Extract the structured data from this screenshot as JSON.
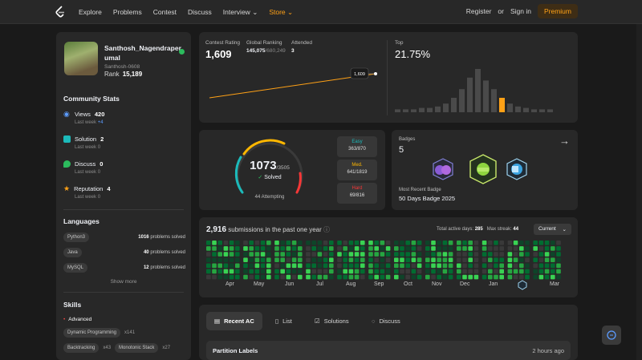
{
  "nav": {
    "items": [
      "Explore",
      "Problems",
      "Contest",
      "Discuss",
      "Interview",
      "Store"
    ],
    "register": "Register",
    "or": "or",
    "signin": "Sign in",
    "premium": "Premium"
  },
  "profile": {
    "name": "Santhosh_Nagendraperumal",
    "handle": "Santhosh-0608",
    "rank_label": "Rank",
    "rank": "15,189"
  },
  "community": {
    "title": "Community Stats",
    "stats": [
      {
        "label": "Views",
        "value": "420",
        "sub": "Last week",
        "delta": "+4"
      },
      {
        "label": "Solution",
        "value": "2",
        "sub": "Last week",
        "delta": "0"
      },
      {
        "label": "Discuss",
        "value": "0",
        "sub": "Last week",
        "delta": "0"
      },
      {
        "label": "Reputation",
        "value": "4",
        "sub": "Last week",
        "delta": "0"
      }
    ]
  },
  "languages": {
    "title": "Languages",
    "items": [
      {
        "name": "Python3",
        "count": "1016",
        "suffix": "problems solved"
      },
      {
        "name": "Java",
        "count": "40",
        "suffix": "problems solved"
      },
      {
        "name": "MySQL",
        "count": "12",
        "suffix": "problems solved"
      }
    ],
    "show_more": "Show more"
  },
  "skills": {
    "title": "Skills",
    "level": "Advanced",
    "items": [
      {
        "name": "Dynamic Programming",
        "count": "x141"
      },
      {
        "name": "Backtracking",
        "count": "x43"
      },
      {
        "name": "Monotonic Stack",
        "count": "x27"
      }
    ]
  },
  "contest": {
    "rating_label": "Contest Rating",
    "rating": "1,609",
    "global_label": "Global Ranking",
    "global": "145,075",
    "global_total": "/680,249",
    "attended_label": "Attended",
    "attended": "3",
    "tooltip": "1,609",
    "top_label": "Top",
    "top": "21.75%",
    "rating_points": [
      1520,
      1560,
      1609
    ],
    "distribution": [
      2,
      2,
      2,
      3,
      3,
      4,
      6,
      10,
      16,
      24,
      30,
      22,
      16,
      10,
      6,
      4,
      3,
      2,
      2,
      2
    ],
    "highlight_index": 13
  },
  "solved": {
    "count": "1073",
    "total": "/3505",
    "solved_label": "Solved",
    "attempting": "44 Attempting",
    "easy_label": "Easy",
    "easy": "363/870",
    "medium_label": "Med.",
    "medium": "641/1819",
    "hard_label": "Hard",
    "hard": "69/816",
    "easy_fraction": 0.417,
    "medium_fraction": 0.352,
    "hard_fraction": 0.085
  },
  "badges": {
    "label": "Badges",
    "count": "5",
    "recent_label": "Most Recent Badge",
    "recent": "50 Days Badge 2025"
  },
  "heatmap": {
    "count": "2,916",
    "caption": "submissions in the past one year",
    "active_label": "Total active days:",
    "active": "285",
    "streak_label": "Max streak:",
    "streak": "44",
    "select": "Current",
    "months": [
      "Apr",
      "May",
      "Jun",
      "Jul",
      "Aug",
      "Sep",
      "Oct",
      "Nov",
      "Dec",
      "Jan",
      "Mar"
    ]
  },
  "tabs": {
    "items": [
      "Recent AC",
      "List",
      "Solutions",
      "Discuss"
    ],
    "first_title": "Partition Labels",
    "first_time": "2 hours ago"
  },
  "colors": {
    "accent": "#ffa116",
    "easy": "#1cbaba",
    "medium": "#ffb700",
    "hard": "#f63737",
    "green": "#2cbb5d"
  }
}
